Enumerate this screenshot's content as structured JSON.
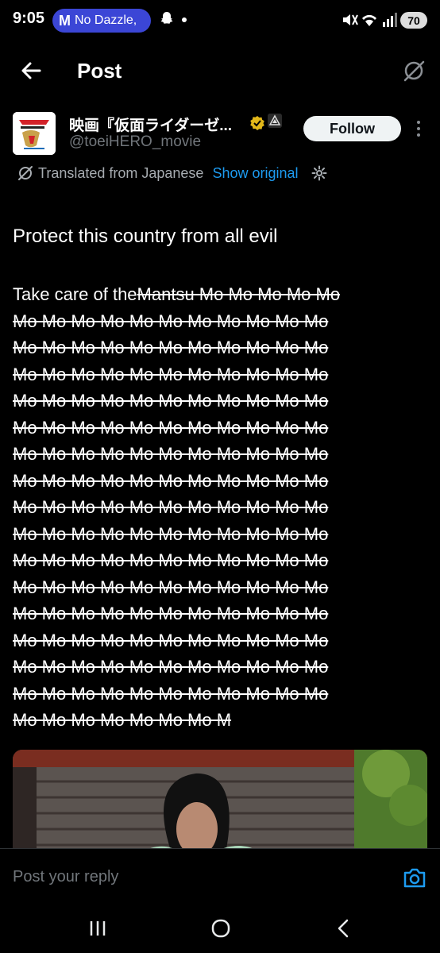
{
  "status_bar": {
    "time": "9:05",
    "pill_letter": "M",
    "pill_text": "No Dazzle,",
    "battery": "70"
  },
  "header": {
    "title": "Post"
  },
  "author": {
    "display_name": "映画『仮面ライダーゼ...",
    "handle": "@toeiHERO_movie",
    "follow_label": "Follow"
  },
  "translation": {
    "label": "Translated from Japanese",
    "show_original": "Show original"
  },
  "post": {
    "line1": "Protect this country from all evil",
    "line2_plain": "Take care of the",
    "line2_strike": "Mantsu Mo Mo Mo Mo Mo",
    "mo_lines": [
      "Mo Mo Mo Mo Mo Mo Mo Mo Mo Mo Mo",
      "Mo Mo Mo Mo Mo Mo Mo Mo Mo Mo Mo",
      "Mo Mo Mo Mo Mo Mo Mo Mo Mo Mo Mo",
      "Mo Mo Mo Mo Mo Mo Mo Mo Mo Mo Mo",
      "Mo Mo Mo Mo Mo Mo Mo Mo Mo Mo Mo",
      "Mo Mo Mo Mo Mo Mo Mo Mo Mo Mo Mo",
      "Mo Mo Mo Mo Mo Mo Mo Mo Mo Mo Mo",
      "Mo Mo Mo Mo Mo Mo Mo Mo Mo Mo Mo",
      "Mo Mo Mo Mo Mo Mo Mo Mo Mo Mo Mo",
      "Mo Mo Mo Mo Mo Mo Mo Mo Mo Mo Mo",
      "Mo Mo Mo Mo Mo Mo Mo Mo Mo Mo Mo",
      "Mo Mo Mo Mo Mo Mo Mo Mo Mo Mo Mo",
      "Mo Mo Mo Mo Mo Mo Mo Mo Mo Mo Mo",
      "Mo Mo Mo Mo Mo Mo Mo Mo Mo Mo Mo",
      "Mo Mo Mo Mo Mo Mo Mo Mo Mo Mo Mo",
      "Mo Mo Mo Mo Mo Mo Mo M"
    ]
  },
  "reply": {
    "placeholder": "Post your reply"
  },
  "colors": {
    "accent": "#1d9bf0",
    "verified": "#e2b719",
    "pill": "#3b46d6"
  },
  "icons": [
    "back-arrow-icon",
    "grok-icon",
    "verified-badge-icon",
    "more-vertical-icon",
    "translate-icon",
    "gear-icon",
    "camera-icon",
    "recents-icon",
    "home-icon",
    "back-icon"
  ]
}
